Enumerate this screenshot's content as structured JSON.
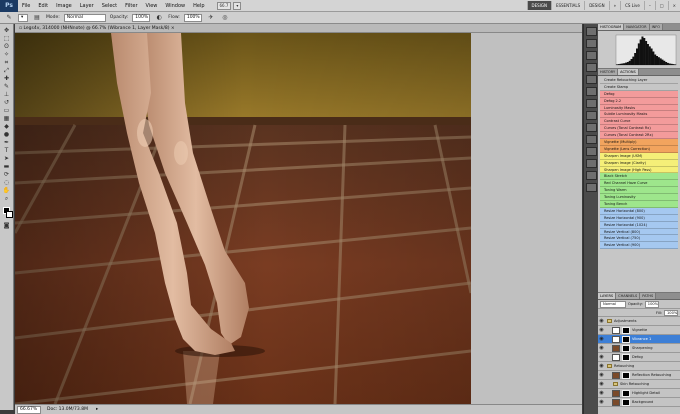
{
  "app": {
    "logo": "Ps",
    "zoom": "66.7",
    "screen_mode": "▾"
  },
  "menu": [
    "File",
    "Edit",
    "Image",
    "Layer",
    "Select",
    "Filter",
    "View",
    "Window",
    "Help"
  ],
  "workspaces": [
    "DESIGN",
    "ESSENTIALS",
    "DESIGN",
    "»",
    "CS Live"
  ],
  "options": {
    "mode_label": "Mode:",
    "mode_value": "Normal",
    "opacity_label": "Opacity:",
    "opacity_value": "100%",
    "flow_label": "Flow:",
    "flow_value": "100%"
  },
  "document": {
    "tab_title": "▫ Legs4v, 314000 (NHNnote) @ 66.7% (Wibrance 1, Layer Mask/8) ×",
    "zoom": "66.67%",
    "status": "Doc: 13.0M/73.8M"
  },
  "panels": {
    "top_tabs": [
      "HISTOGRAM",
      "NAVIGATOR",
      "INFO"
    ],
    "mid_tabs": [
      "HISTORY",
      "ACTIONS"
    ],
    "layer_tabs": [
      "LAYERS",
      "CHANNELS",
      "PATHS"
    ],
    "blend": "Normal",
    "opacity_label": "Opacity:",
    "opacity": "100%",
    "fill_label": "Fill:",
    "fill": "100%"
  },
  "actions": [
    {
      "label": "Create Retouching Layer",
      "color": "#c6c6c6"
    },
    {
      "label": "Create Stamp",
      "color": "#c6c6c6"
    },
    {
      "label": "Defog",
      "color": "#f39b9b"
    },
    {
      "label": "Defog 2.2",
      "color": "#f39b9b"
    },
    {
      "label": "Luminosity Masks",
      "color": "#f39b9b"
    },
    {
      "label": "Subtle Luminosity Masks",
      "color": "#f39b9b"
    },
    {
      "label": "Contrast Curve",
      "color": "#f39b9b"
    },
    {
      "label": "Curves (Tonal Contrast Rx)",
      "color": "#f39b9b"
    },
    {
      "label": "Curves (Tonal Contrast 2Rx)",
      "color": "#f39b9b"
    },
    {
      "label": "Vignette (Multiply)",
      "color": "#f2a45e"
    },
    {
      "label": "Vignette (Lens Correction)",
      "color": "#f2a45e"
    },
    {
      "label": "Sharpen Image (USM)",
      "color": "#f5ef78"
    },
    {
      "label": "Sharpen Image (Clarity)",
      "color": "#f5ef78"
    },
    {
      "label": "Sharpen Image (High Pass)",
      "color": "#f5ef78"
    },
    {
      "label": "Black Stretch",
      "color": "#9ee68c"
    },
    {
      "label": "Red Channel Haze Curve",
      "color": "#9ee68c"
    },
    {
      "label": "Toning Warm",
      "color": "#9ee68c"
    },
    {
      "label": "Toning Luminosity",
      "color": "#9ee68c"
    },
    {
      "label": "Toning Bench",
      "color": "#9ee68c"
    },
    {
      "label": "Resize Horizontal (800)",
      "color": "#a5c8f0"
    },
    {
      "label": "Resize Horizontal (900)",
      "color": "#a5c8f0"
    },
    {
      "label": "Resize Horizontal (1024)",
      "color": "#a5c8f0"
    },
    {
      "label": "Resize Vertical (800)",
      "color": "#a5c8f0"
    },
    {
      "label": "Resize Vertical (750)",
      "color": "#a5c8f0"
    },
    {
      "label": "Resize Vertical (900)",
      "color": "#a5c8f0"
    }
  ],
  "layers": [
    {
      "name": "Adjustments",
      "type": "group",
      "indent": 0,
      "selected": false
    },
    {
      "name": "Vignette",
      "type": "adj",
      "indent": 1,
      "selected": false
    },
    {
      "name": "Vibrance 1",
      "type": "adj",
      "indent": 1,
      "selected": true
    },
    {
      "name": "Sharpening",
      "type": "photo",
      "indent": 1,
      "selected": false
    },
    {
      "name": "Defog",
      "type": "adj",
      "indent": 1,
      "selected": false
    },
    {
      "name": "Retouching",
      "type": "group",
      "indent": 0,
      "selected": false
    },
    {
      "name": "Reflection Retouching",
      "type": "photo",
      "indent": 1,
      "selected": false
    },
    {
      "name": "Skin Retouching",
      "type": "group",
      "indent": 1,
      "selected": false
    },
    {
      "name": "Highlight Detail",
      "type": "photo",
      "indent": 1,
      "selected": false
    },
    {
      "name": "Background",
      "type": "photo",
      "indent": 1,
      "selected": false
    }
  ],
  "histogram": {
    "levels": [
      0.02,
      0.03,
      0.04,
      0.05,
      0.06,
      0.08,
      0.1,
      0.14,
      0.2,
      0.28,
      0.4,
      0.55,
      0.72,
      0.85,
      0.95,
      0.9,
      0.8,
      0.7,
      0.62,
      0.55,
      0.45,
      0.35,
      0.3,
      0.26,
      0.22,
      0.18,
      0.14,
      0.1,
      0.07,
      0.05,
      0.04,
      0.03,
      0.02
    ]
  }
}
